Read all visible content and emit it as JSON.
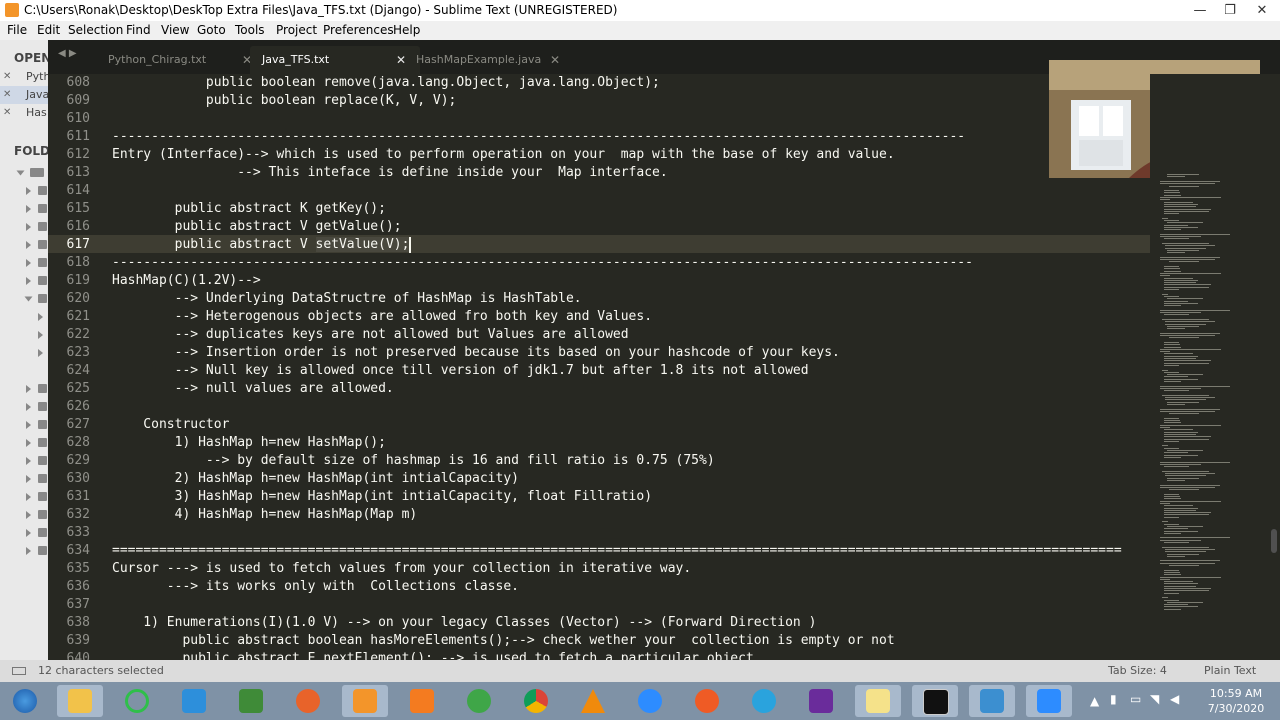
{
  "window": {
    "title": "C:\\Users\\Ronak\\Desktop\\DeskTop Extra Files\\Java_TFS.txt (Django) - Sublime Text (UNREGISTERED)",
    "minimize": "—",
    "restore": "❐",
    "close": "✕"
  },
  "menu": [
    "File",
    "Edit",
    "Selection",
    "Find",
    "View",
    "Goto",
    "Tools",
    "Project",
    "Preferences",
    "Help"
  ],
  "sidebar": {
    "open_files_header": "OPEN",
    "open_files": [
      "Pyth",
      "Java",
      "Has"
    ],
    "folders_header": "FOLD"
  },
  "tabs": [
    {
      "label": "Python_Chirag.txt",
      "close": "✕"
    },
    {
      "label": "Java_TFS.txt",
      "close": "✕"
    },
    {
      "label": "HashMapExample.java",
      "close": "✕"
    }
  ],
  "tab_nav": "◀ ▶",
  "editor": {
    "lines": [
      {
        "n": "608",
        "t": "            public boolean remove(java.lang.Object, java.lang.Object);"
      },
      {
        "n": "609",
        "t": "            public boolean replace(K, V, V);"
      },
      {
        "n": "610",
        "t": ""
      },
      {
        "n": "611",
        "t": "-------------------------------------------------------------------------------------------------------------"
      },
      {
        "n": "612",
        "t": "Entry (Interface)--> which is used to perform operation on your  map with the base of key and value."
      },
      {
        "n": "613",
        "t": "                --> This inteface is define inside your  Map interface."
      },
      {
        "n": "614",
        "t": ""
      },
      {
        "n": "615",
        "t": "        public abstract K getKey();"
      },
      {
        "n": "616",
        "t": "        public abstract V getValue();"
      },
      {
        "n": "617",
        "t": "        public abstract V setValue(V);"
      },
      {
        "n": "618",
        "t": "--------------------------------------------------------------------------------------------------------------"
      },
      {
        "n": "619",
        "t": "HashMap(C)(1.2V)-->"
      },
      {
        "n": "620",
        "t": "        --> Underlying DataStructre of HashMap is HashTable."
      },
      {
        "n": "621",
        "t": "        --> Heterogenous objects are allowed fro both key and Values."
      },
      {
        "n": "622",
        "t": "        --> duplicates keys are not allowed but Values are allowed"
      },
      {
        "n": "623",
        "t": "        --> Insertion order is not preserved because its based on your hashcode of your keys."
      },
      {
        "n": "624",
        "t": "        --> Null key is allowed once till version of jdk1.7 but after 1.8 its not allowed"
      },
      {
        "n": "625",
        "t": "        --> null values are allowed."
      },
      {
        "n": "626",
        "t": ""
      },
      {
        "n": "627",
        "t": "    Constructor"
      },
      {
        "n": "628",
        "t": "        1) HashMap h=new HashMap();"
      },
      {
        "n": "629",
        "t": "            --> by default size of hashmap is 16 and fill ratio is 0.75 (75%)"
      },
      {
        "n": "630",
        "t": "        2) HashMap h=new HashMap(int intialCapacity)"
      },
      {
        "n": "631",
        "t": "        3) HashMap h=new HashMap(int intialCapacity, float Fillratio)"
      },
      {
        "n": "632",
        "t": "        4) HashMap h=new HashMap(Map m)"
      },
      {
        "n": "633",
        "t": ""
      },
      {
        "n": "634",
        "t": "================================================================================================================================="
      },
      {
        "n": "635",
        "t": "Cursor ---> is used to fetch values from your collection in iterative way."
      },
      {
        "n": "636",
        "t": "       ---> its works only with  Collections classe."
      },
      {
        "n": "637",
        "t": ""
      },
      {
        "n": "638",
        "t": "    1) Enumerations(I)(1.0 V) --> on your legacy Classes (Vector) --> (Forward Direction )"
      },
      {
        "n": "639",
        "t": "         public abstract boolean hasMoreElements();--> check wether your  collection is empty or not"
      },
      {
        "n": "640",
        "t": "         public abstract E nextElement(); --> is used to fetch a particular object."
      }
    ]
  },
  "status": {
    "selection": "12 characters selected",
    "tab_size": "Tab Size: 4",
    "syntax": "Plain Text"
  },
  "clock": {
    "time": "10:59 AM",
    "date": "7/30/2020"
  },
  "taskbar": [
    "start",
    "file-explorer",
    "cortana",
    "vscode",
    "sublime-green",
    "firefox",
    "sublime-text",
    "xampp",
    "terminal-green",
    "chrome",
    "vlc",
    "zoom",
    "postman",
    "telegram",
    "visual-studio",
    "notes",
    "cmd",
    "paint",
    "zoom-meetings"
  ],
  "colors": {
    "editor_bg": "#272822",
    "fg": "#f8f8f2",
    "gutter_fg": "#90908a"
  }
}
